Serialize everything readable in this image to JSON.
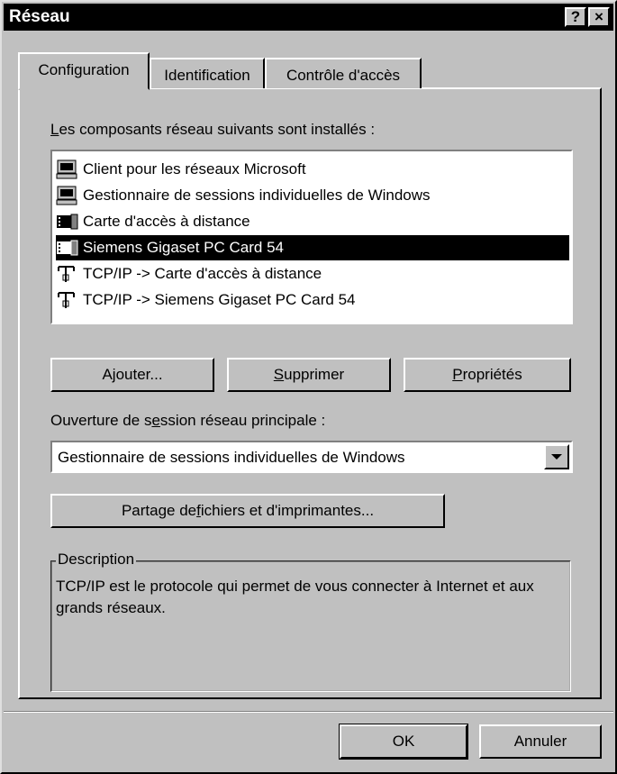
{
  "window": {
    "title": "Réseau",
    "help_btn": "?",
    "close_btn": "×"
  },
  "tabs": [
    {
      "label": "Configuration",
      "active": true
    },
    {
      "label": "Identification",
      "active": false
    },
    {
      "label": "Contrôle d'accès",
      "active": false
    }
  ],
  "components": {
    "label_prefix": "L",
    "label_rest": "es composants réseau suivants sont installés :",
    "items": [
      {
        "label": "Client pour les réseaux Microsoft",
        "icon": "computer-icon"
      },
      {
        "label": "Gestionnaire de sessions individuelles de Windows",
        "icon": "computer-icon"
      },
      {
        "label": "Carte d'accès à distance",
        "icon": "network-card-icon"
      },
      {
        "label": "Siemens Gigaset PC Card 54",
        "icon": "network-card-icon",
        "selected": true
      },
      {
        "label": "TCP/IP -> Carte d'accès à distance",
        "icon": "protocol-icon"
      },
      {
        "label": "TCP/IP -> Siemens Gigaset PC Card 54",
        "icon": "protocol-icon"
      }
    ]
  },
  "buttons": {
    "add_a": "A",
    "add_u": "j",
    "add_b": "outer...",
    "remove_u": "S",
    "remove_b": "upprimer",
    "props_u": "P",
    "props_b": "ropriétés",
    "share_a": "Partage de ",
    "share_u": "f",
    "share_b": "ichiers et d'imprimantes...",
    "ok": "OK",
    "cancel": "Annuler"
  },
  "logon": {
    "label_a": "Ouverture de s",
    "label_u": "e",
    "label_b": "ssion réseau principale :",
    "value": "Gestionnaire de sessions individuelles de Windows"
  },
  "description": {
    "legend": "Description",
    "text": "TCP/IP est le protocole qui permet de vous connecter à Internet et aux grands réseaux."
  }
}
